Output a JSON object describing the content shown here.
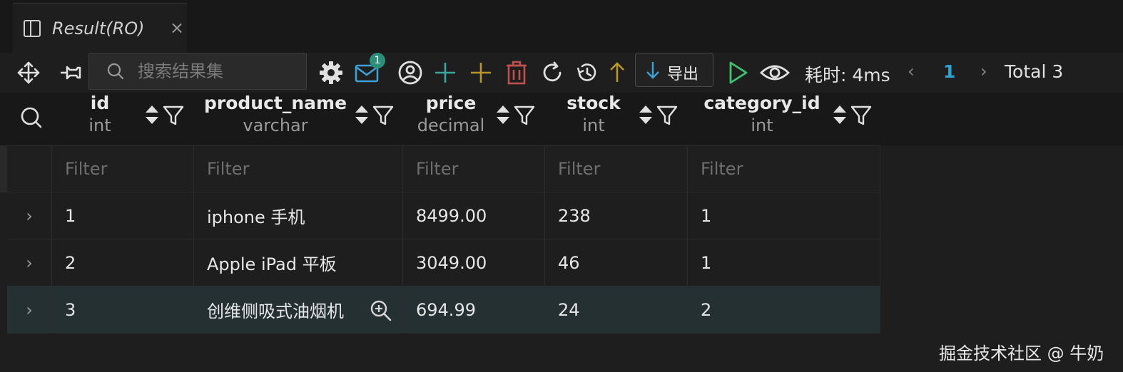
{
  "tab": {
    "title": "Result(RO)",
    "close": "×",
    "icon": "panel-layout-icon"
  },
  "toolbar": {
    "search_placeholder": "搜索结果集",
    "badge_count": "1",
    "export_label": "导出",
    "elapsed": "耗时: 4ms",
    "prev": "‹",
    "page": "1",
    "next": "›",
    "total": "Total 3",
    "icons": [
      "move-icon",
      "pin-icon",
      "search-icon",
      "gear-icon",
      "mail-icon",
      "user-icon",
      "add-icon",
      "add-row-icon",
      "trash-icon",
      "refresh-icon",
      "history-icon",
      "arrow-up-icon",
      "arrow-down-icon",
      "play-icon",
      "eye-icon"
    ]
  },
  "columns": [
    {
      "name": "id",
      "type": "int"
    },
    {
      "name": "product_name",
      "type": "varchar"
    },
    {
      "name": "price",
      "type": "decimal"
    },
    {
      "name": "stock",
      "type": "int"
    },
    {
      "name": "category_id",
      "type": "int"
    }
  ],
  "filters": [
    "Filter",
    "Filter",
    "Filter",
    "Filter",
    "Filter"
  ],
  "rows": [
    {
      "expander": "›",
      "cells": [
        "1",
        "iphone 手机",
        "8499.00",
        "238",
        "1"
      ]
    },
    {
      "expander": "›",
      "cells": [
        "2",
        "Apple iPad 平板",
        "3049.00",
        "46",
        "1"
      ]
    },
    {
      "expander": "›",
      "cells": [
        "3",
        "创维侧吸式油烟机",
        "694.99",
        "24",
        "2"
      ]
    }
  ],
  "watermark": "掘金技术社区 @ 牛奶",
  "colors": {
    "accent": "#2aa3d8",
    "badge": "#2b8f7a",
    "play": "#3ec46d",
    "trash": "#c0504d",
    "add_teal": "#3aa6a0",
    "add_gold": "#b8962a"
  }
}
